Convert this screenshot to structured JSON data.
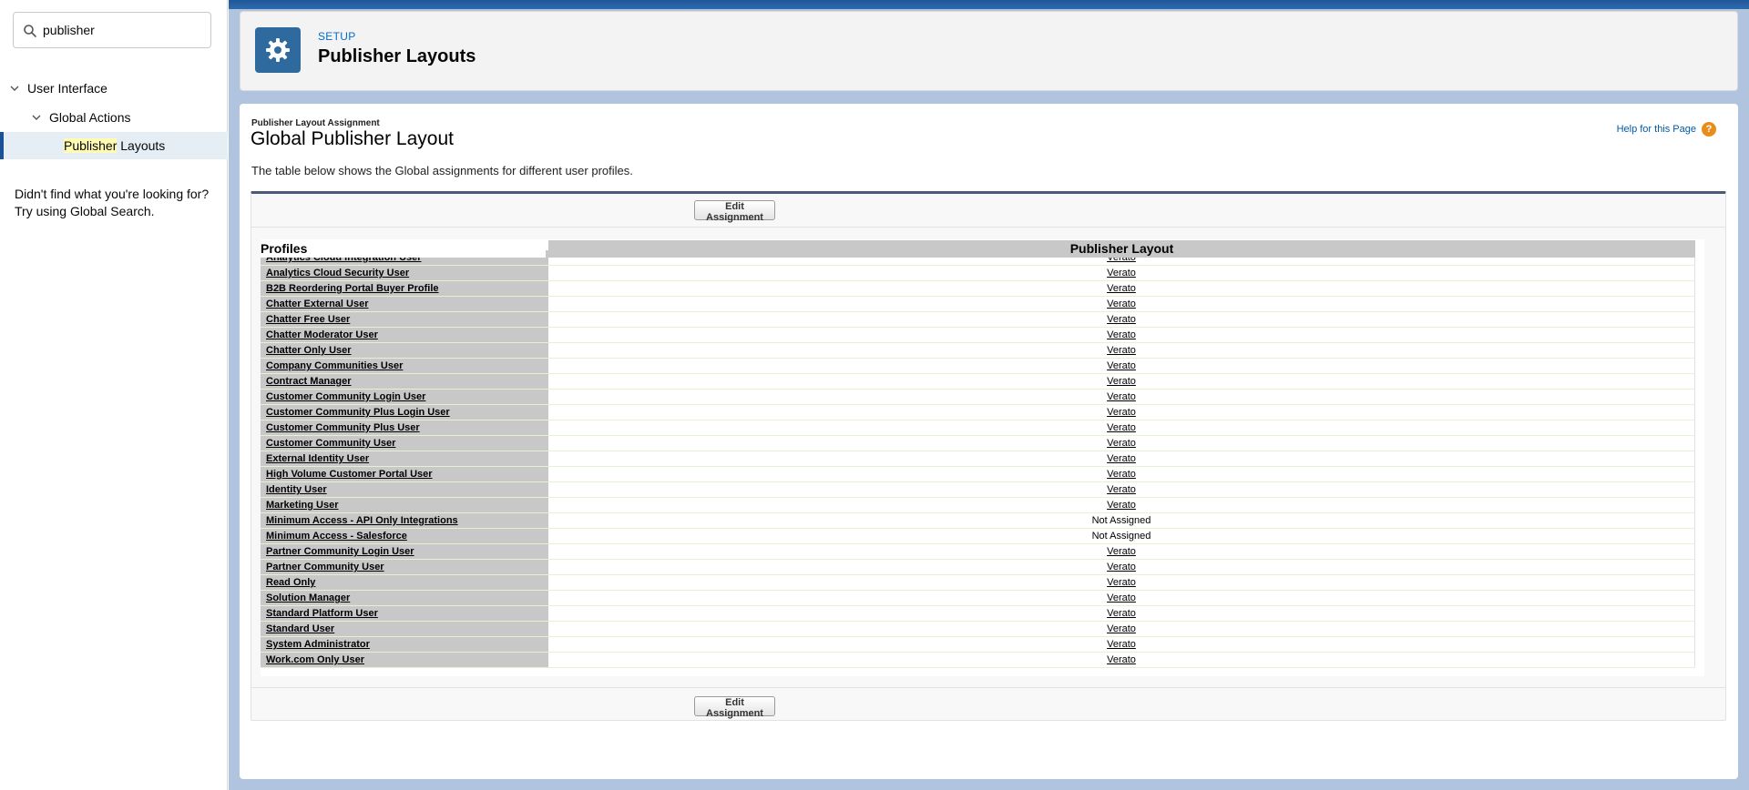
{
  "sidebar": {
    "search_value": "publisher",
    "tree": {
      "level1": "User Interface",
      "level2": "Global Actions",
      "level3_highlight": "Publisher",
      "level3_rest": " Layouts"
    },
    "not_found_line1": "Didn't find what you're looking for?",
    "not_found_line2": "Try using Global Search."
  },
  "header": {
    "setup_label": "SETUP",
    "title": "Publisher Layouts"
  },
  "content": {
    "section_small": "Publisher Layout Assignment",
    "section_title": "Global Publisher Layout",
    "help_link": "Help for this Page",
    "description": "The table below shows the Global assignments for different user profiles.",
    "edit_button": "Edit Assignment",
    "col_profiles": "Profiles",
    "col_layout": "Publisher Layout"
  },
  "rows": [
    {
      "profile": "Analytics Cloud Integration User",
      "layout": "Verato",
      "link": true
    },
    {
      "profile": "Analytics Cloud Security User",
      "layout": "Verato",
      "link": true
    },
    {
      "profile": "B2B Reordering Portal Buyer Profile",
      "layout": "Verato",
      "link": true
    },
    {
      "profile": "Chatter External User",
      "layout": "Verato",
      "link": true
    },
    {
      "profile": "Chatter Free User",
      "layout": "Verato",
      "link": true
    },
    {
      "profile": "Chatter Moderator User",
      "layout": "Verato",
      "link": true
    },
    {
      "profile": "Chatter Only User",
      "layout": "Verato",
      "link": true
    },
    {
      "profile": "Company Communities User",
      "layout": "Verato",
      "link": true
    },
    {
      "profile": "Contract Manager",
      "layout": "Verato",
      "link": true
    },
    {
      "profile": "Customer Community Login User",
      "layout": "Verato",
      "link": true
    },
    {
      "profile": "Customer Community Plus Login User",
      "layout": "Verato",
      "link": true
    },
    {
      "profile": "Customer Community Plus User",
      "layout": "Verato",
      "link": true
    },
    {
      "profile": "Customer Community User",
      "layout": "Verato",
      "link": true
    },
    {
      "profile": "External Identity User",
      "layout": "Verato",
      "link": true
    },
    {
      "profile": "High Volume Customer Portal User",
      "layout": "Verato",
      "link": true
    },
    {
      "profile": "Identity User",
      "layout": "Verato",
      "link": true
    },
    {
      "profile": "Marketing User",
      "layout": "Verato",
      "link": true
    },
    {
      "profile": "Minimum Access - API Only Integrations",
      "layout": "Not Assigned",
      "link": false
    },
    {
      "profile": "Minimum Access - Salesforce",
      "layout": "Not Assigned",
      "link": false
    },
    {
      "profile": "Partner Community Login User",
      "layout": "Verato",
      "link": true
    },
    {
      "profile": "Partner Community User",
      "layout": "Verato",
      "link": true
    },
    {
      "profile": "Read Only",
      "layout": "Verato",
      "link": true
    },
    {
      "profile": "Solution Manager",
      "layout": "Verato",
      "link": true
    },
    {
      "profile": "Standard Platform User",
      "layout": "Verato",
      "link": true
    },
    {
      "profile": "Standard User",
      "layout": "Verato",
      "link": true
    },
    {
      "profile": "System Administrator",
      "layout": "Verato",
      "link": true
    },
    {
      "profile": "Work.com Only User",
      "layout": "Verato",
      "link": true
    }
  ],
  "colors": {
    "accent": "#2f6a9f",
    "link": "#015ba7",
    "highlight": "#fffbb2"
  }
}
